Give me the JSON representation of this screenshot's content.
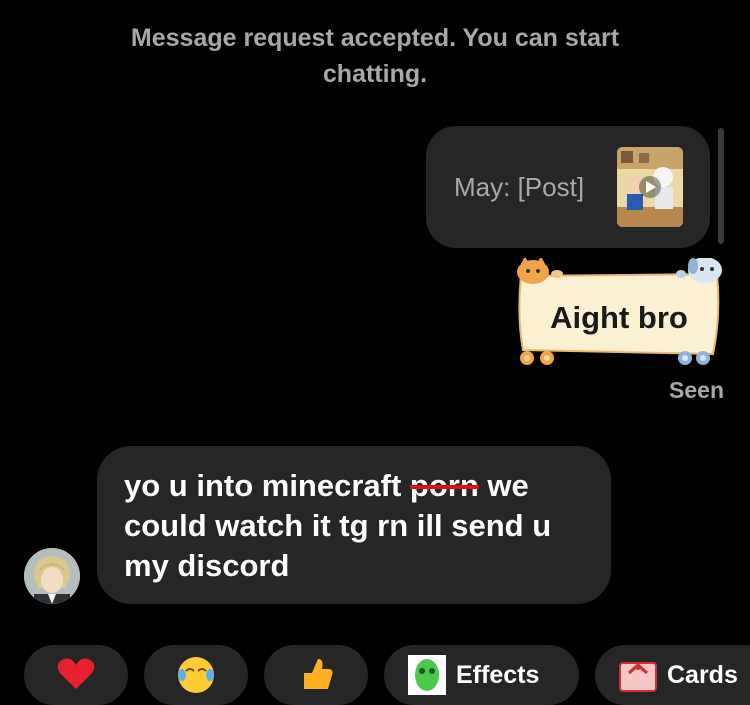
{
  "system_message": "Message request accepted. You can start chatting.",
  "outgoing_post": {
    "label": "May: [Post]",
    "thumbnail_icon": "cartoon-post-thumbnail"
  },
  "outgoing_sticker_message": {
    "text": "Aight bro",
    "frame_icon": "cat-dog-sticker-frame"
  },
  "status": {
    "seen_label": "Seen"
  },
  "incoming_message": {
    "text_before": "yo u into minecraft ",
    "struck_word": "porn",
    "text_after": " we could watch it tg rn ill send u my discord",
    "sender_avatar_icon": "anime-avatar"
  },
  "quick_reactions": [
    {
      "icon": "heart-emoji"
    },
    {
      "icon": "laughing-tears-emoji"
    },
    {
      "icon": "thumbs-up-emoji"
    },
    {
      "icon": "effects-icon",
      "label": "Effects"
    },
    {
      "icon": "cards-icon",
      "label": "Cards"
    }
  ],
  "colors": {
    "background": "#000000",
    "bubble": "#262626",
    "muted_text": "#a8a8a8",
    "sticker_paper": "#fbf0d2",
    "strike": "#e01010"
  }
}
